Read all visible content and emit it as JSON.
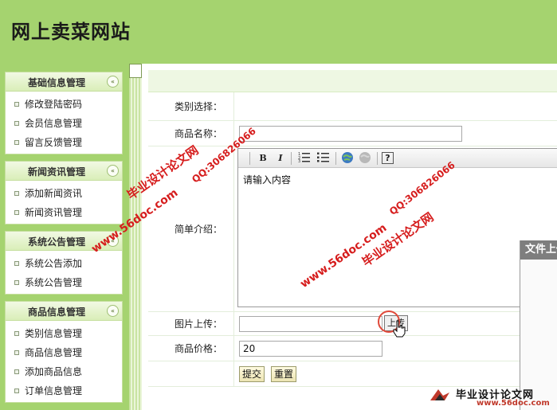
{
  "site": {
    "title": "网上卖菜网站"
  },
  "sidebar": {
    "panels": [
      {
        "title": "基础信息管理",
        "items": [
          "修改登陆密码",
          "会员信息管理",
          "留言反馈管理"
        ]
      },
      {
        "title": "新闻资讯管理",
        "items": [
          "添加新闻资讯",
          "新闻资讯管理"
        ]
      },
      {
        "title": "系统公告管理",
        "items": [
          "系统公告添加",
          "系统公告管理"
        ]
      },
      {
        "title": "商品信息管理",
        "items": [
          "类别信息管理",
          "商品信息管理",
          "添加商品信息",
          "订单信息管理"
        ]
      }
    ],
    "collapse_glyph": "«"
  },
  "form": {
    "category_label": "类别选择：",
    "name_label": "商品名称：",
    "name_value": "",
    "intro_label": "简单介绍：",
    "editor_placeholder_text": "请输入内容",
    "image_label": "图片上传：",
    "image_value": "",
    "upload_button_label": "上传",
    "price_label": "商品价格：",
    "price_value": "20",
    "submit_label": "提交",
    "reset_label": "重置"
  },
  "editor_toolbar": {
    "icons": [
      "bold-icon",
      "italic-icon",
      "ordered-list-icon",
      "unordered-list-icon",
      "link-icon",
      "unlink-icon",
      "help-icon"
    ],
    "bold_glyph": "B",
    "italic_glyph": "I",
    "help_glyph": "?"
  },
  "file_panel": {
    "title": "文件上传"
  },
  "watermarks": {
    "cn": "毕业设计论文网",
    "url": "www.56doc.com",
    "qq": "QQ:306826066",
    "logo_text": "毕业设计论文网",
    "logo_url": "www.56doc.com"
  },
  "colors": {
    "header_bg": "#a5d36f",
    "watermark_red": "#d61d1d"
  }
}
